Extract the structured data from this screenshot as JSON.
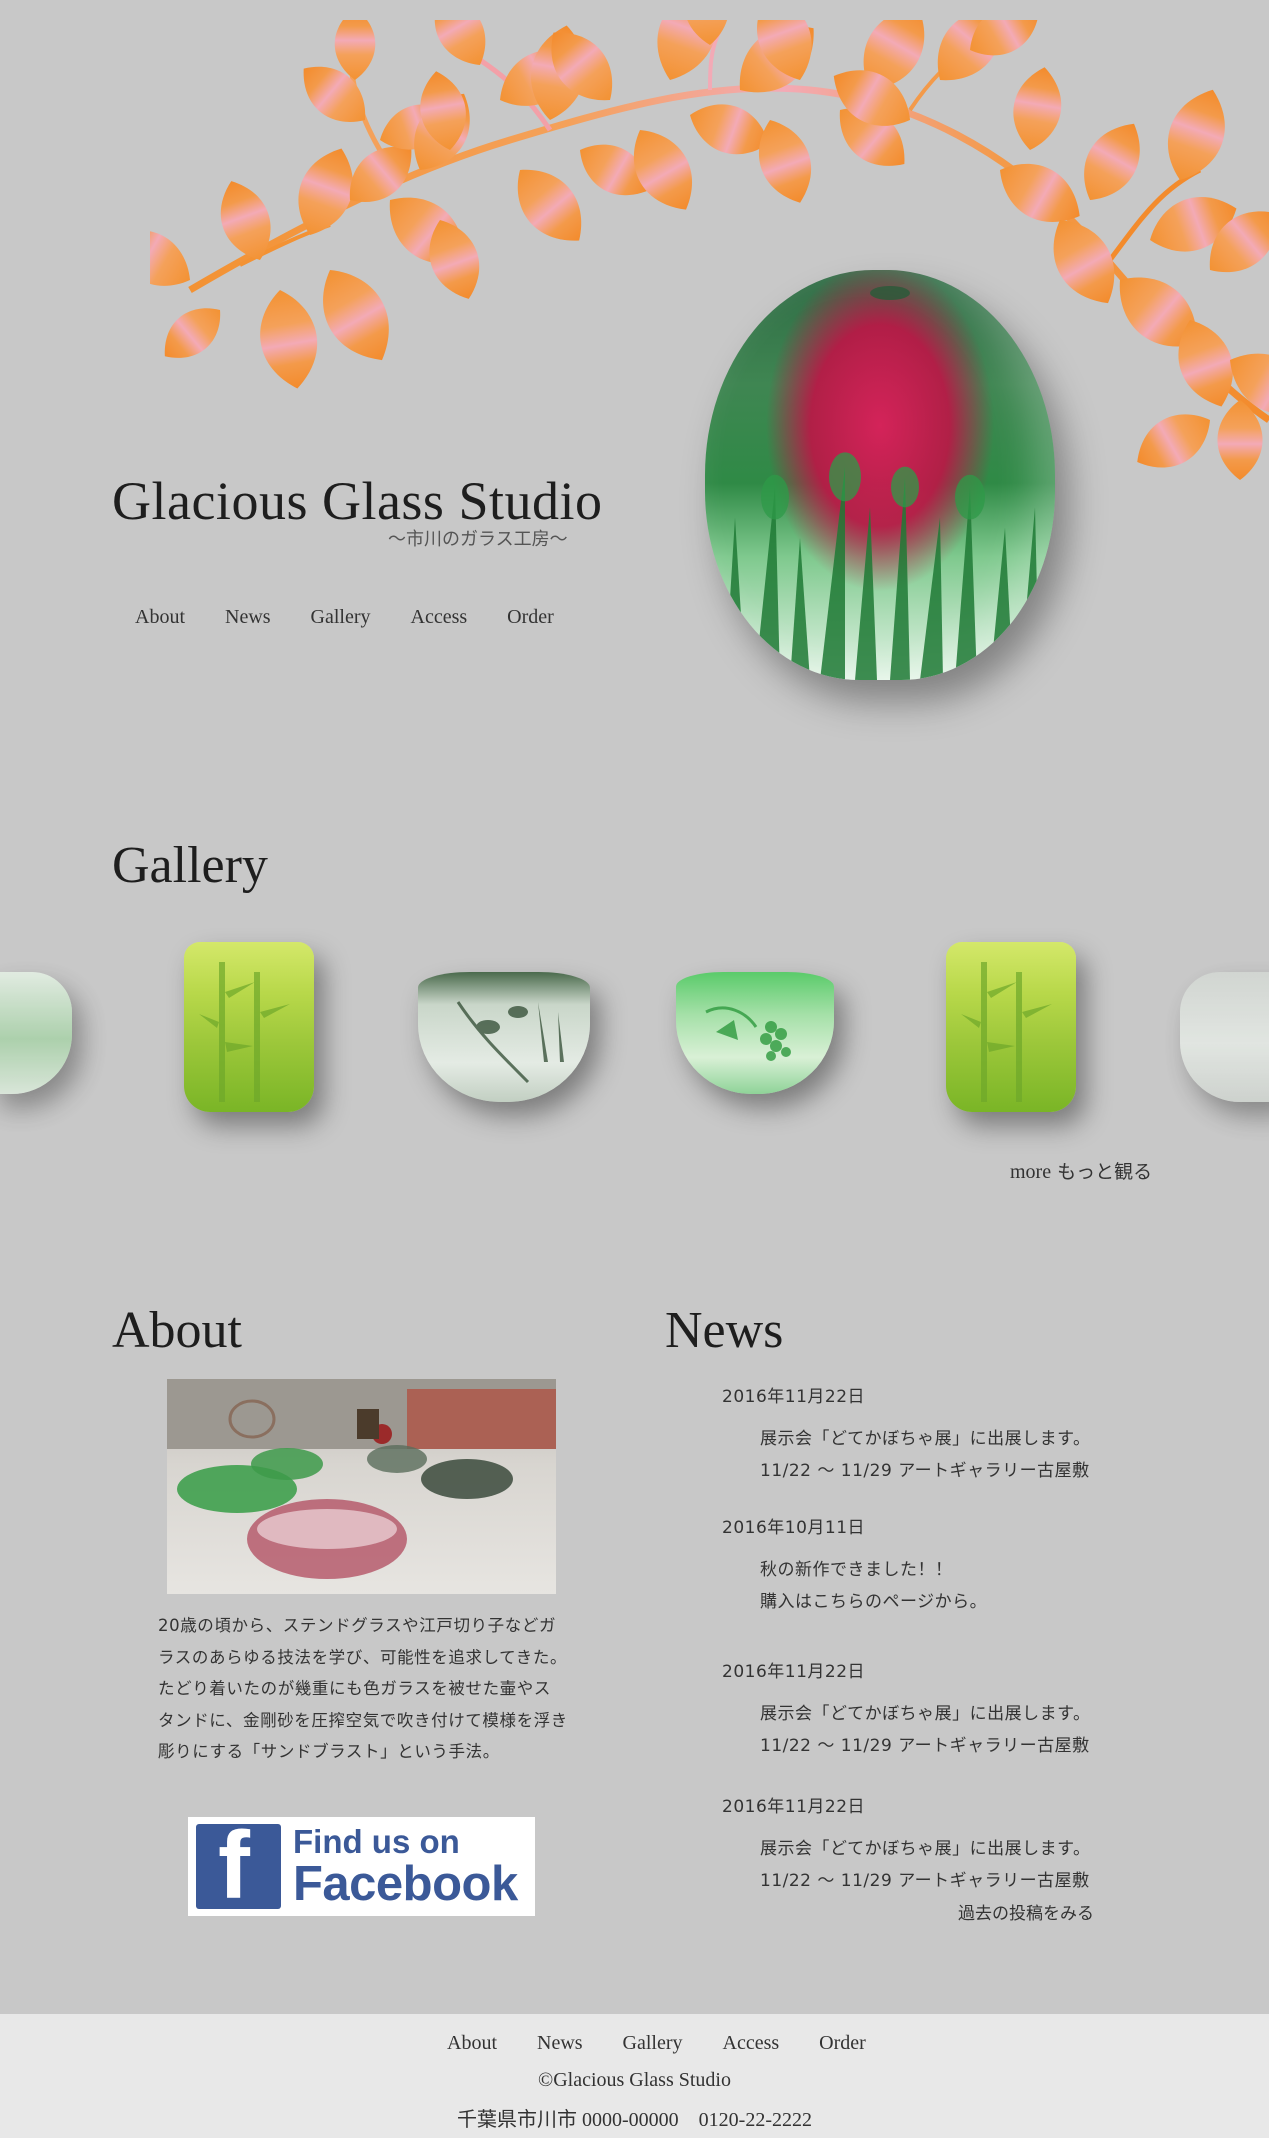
{
  "header": {
    "title": "Glacious Glass Studio",
    "subtitle": "〜市川のガラス工房〜"
  },
  "nav": [
    "About",
    "News",
    "Gallery",
    "Access",
    "Order"
  ],
  "gallery": {
    "heading": "Gallery",
    "more_en": "more",
    "more_jp": "もっと観る"
  },
  "about": {
    "heading": "About",
    "text": "20歳の頃から、ステンドグラスや江戸切り子などガラスのあらゆる技法を学び、可能性を追求してきた。たどり着いたのが幾重にも色ガラスを被せた壷やスタンドに、金剛砂を圧搾空気で吹き付けて模様を浮き彫りにする「サンドブラスト」という手法。",
    "facebook_line1": "Find us on",
    "facebook_line2": "Facebook"
  },
  "news": {
    "heading": "News",
    "items": [
      {
        "date": "2016年11月22日",
        "line1": "展示会「どてかぼちゃ展」に出展します。",
        "line2": "11/22 〜 11/29 アートギャラリー古屋敷"
      },
      {
        "date": "2016年10月11日",
        "line1": "秋の新作できました！！",
        "line2": "購入はこちらのページから。"
      },
      {
        "date": "2016年11月22日",
        "line1": "展示会「どてかぼちゃ展」に出展します。",
        "line2": "11/22 〜 11/29 アートギャラリー古屋敷"
      },
      {
        "date": "2016年11月22日",
        "line1": "展示会「どてかぼちゃ展」に出展します。",
        "line2": "11/22 〜 11/29 アートギャラリー古屋敷"
      }
    ],
    "past_link": "過去の投稿をみる"
  },
  "footer": {
    "nav": [
      "About",
      "News",
      "Gallery",
      "Access",
      "Order"
    ],
    "copyright": "©Glacious Glass Studio",
    "address": "千葉県市川市 0000-00000　0120-22-2222"
  }
}
